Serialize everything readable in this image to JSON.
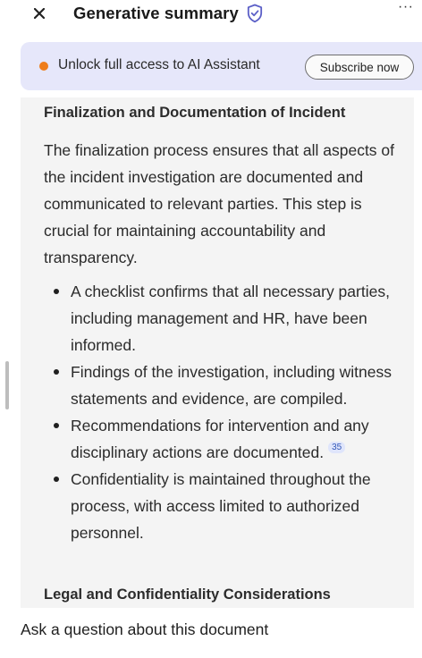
{
  "header": {
    "title": "Generative summary",
    "more_label": "···"
  },
  "banner": {
    "text": "Unlock full access to AI Assistant",
    "subscribe_label": "Subscribe now",
    "dot_color": "#ef7d1a"
  },
  "content": {
    "section_title": "Finalization and Documentation of Incident",
    "paragraph": "The finalization process ensures that all aspects of the incident investigation are documented and communicated to relevant parties. This step is crucial for maintaining accountability and transparency.",
    "bullets": [
      {
        "text": "A checklist confirms that all necessary parties, including management and HR, have been informed."
      },
      {
        "text": "Findings of the investigation, including witness statements and evidence, are compiled."
      },
      {
        "text": "Recommendations for intervention and any disciplinary actions are documented.",
        "citation": "35"
      },
      {
        "text": "Confidentiality is maintained throughout the process, with access limited to authorized personnel."
      }
    ],
    "next_section_title": "Legal and Confidentiality Considerations"
  },
  "footer": {
    "ask_text": "Ask a question about this document"
  },
  "colors": {
    "accent": "#5b5fc7",
    "banner_bg": "#e6e7fa",
    "citation_bg": "#dfe5fb"
  }
}
